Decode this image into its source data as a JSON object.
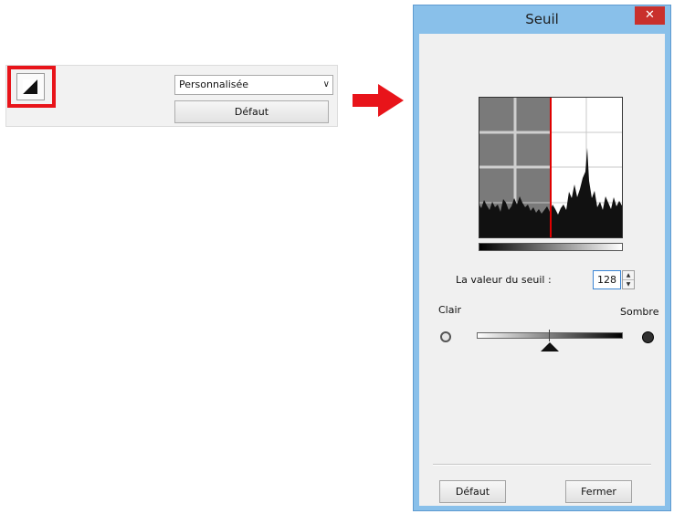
{
  "toolbar": {
    "tool_icon": "threshold-icon",
    "preset_value": "Personnalisée",
    "default_label": "Défaut"
  },
  "dialog": {
    "title": "Seuil",
    "close_label": "✕",
    "threshold_label": "La valeur du seuil :",
    "threshold_value": "128",
    "light_label": "Clair",
    "dark_label": "Sombre",
    "default_button": "Défaut",
    "close_button": "Fermer"
  },
  "colors": {
    "highlight": "#e8141a",
    "arrow": "#e8141a",
    "dialog_frame": "#89c0ea",
    "close_button": "#c9302c",
    "threshold_line": "#e00000"
  }
}
